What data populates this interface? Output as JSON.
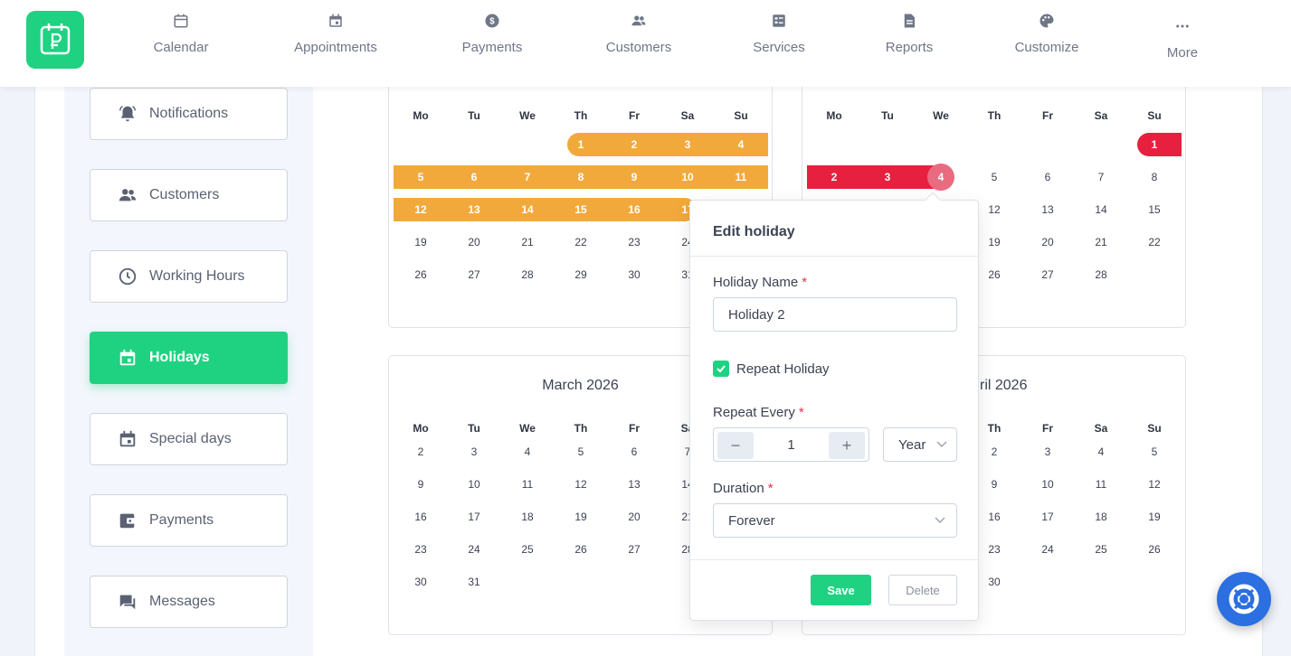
{
  "nav": [
    {
      "label": "Calendar",
      "icon": "calendar-icon"
    },
    {
      "label": "Appointments",
      "icon": "appointments-icon"
    },
    {
      "label": "Payments",
      "icon": "payments-icon"
    },
    {
      "label": "Customers",
      "icon": "customers-icon"
    },
    {
      "label": "Services",
      "icon": "services-icon"
    },
    {
      "label": "Reports",
      "icon": "reports-icon"
    },
    {
      "label": "Customize",
      "icon": "palette-icon"
    },
    {
      "label": "More",
      "icon": "more-icon"
    }
  ],
  "sidebar": [
    {
      "label": "Notifications",
      "icon": "bell-icon"
    },
    {
      "label": "Customers",
      "icon": "customers-icon"
    },
    {
      "label": "Working Hours",
      "icon": "clock-icon"
    },
    {
      "label": "Holidays",
      "icon": "calendar-event-icon",
      "active": true
    },
    {
      "label": "Special days",
      "icon": "calendar-event-icon"
    },
    {
      "label": "Payments",
      "icon": "wallet-icon"
    },
    {
      "label": "Messages",
      "icon": "chat-icon"
    }
  ],
  "weekdays": [
    "Mo",
    "Tu",
    "We",
    "Th",
    "Fr",
    "Sa",
    "Su"
  ],
  "calendars": {
    "jan": {
      "title": ""
    },
    "feb": {
      "title": ""
    },
    "mar": {
      "title": "March 2026"
    },
    "apr": {
      "title": "ril 2026"
    }
  },
  "colors": {
    "accent": "#1fd282",
    "holiday_orange": "#f2a93b",
    "holiday_red": "#e8203f",
    "help_blue": "#2b6fe0"
  },
  "popover": {
    "title": "Edit holiday",
    "name_label": "Holiday Name",
    "name_value": "Holiday 2",
    "repeat_label": "Repeat Holiday",
    "repeat_checked": true,
    "every_label": "Repeat Every",
    "every_value": "1",
    "minus": "−",
    "plus": "+",
    "unit": "Year",
    "duration_label": "Duration",
    "duration_value": "Forever",
    "required_mark": "*",
    "save": "Save",
    "delete": "Delete"
  }
}
